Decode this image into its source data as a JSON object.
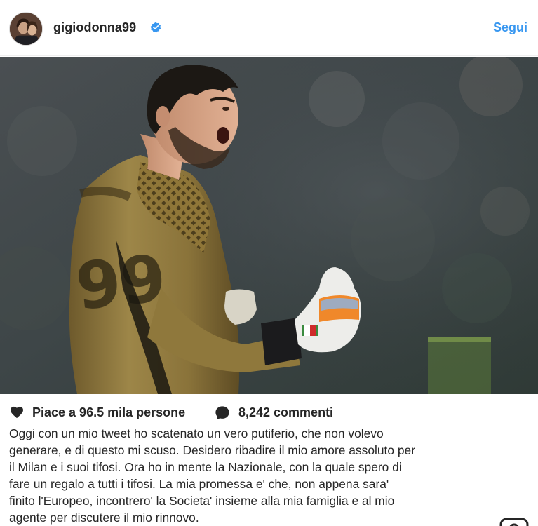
{
  "header": {
    "username": "gigiodonna99",
    "verified_icon": "verified-badge-icon",
    "follow_label": "Segui"
  },
  "post": {
    "image_icon": "photo-goalkeeper"
  },
  "stats": {
    "likes_label": "Piace a 96.5 mila persone",
    "comments_label": "8,242 commenti"
  },
  "caption": {
    "lines": [
      "Oggi con un mio tweet ho scatenato un vero putiferio, che non volevo",
      "generare, e di questo mi scuso. Desidero ribadire il mio amore assoluto per",
      "il Milan e i suoi tifosi. Ora ho in mente la Nazionale, con la quale spero di",
      "fare un regalo a tutti i tifosi. La mia promessa e' che, non appena sara'",
      "finito l'Europeo, incontrero' la Societa' insieme alla mia famiglia e al mio",
      "agente per discutere il mio rinnovo."
    ]
  },
  "colors": {
    "accent": "#3897f0",
    "text": "#262626"
  }
}
